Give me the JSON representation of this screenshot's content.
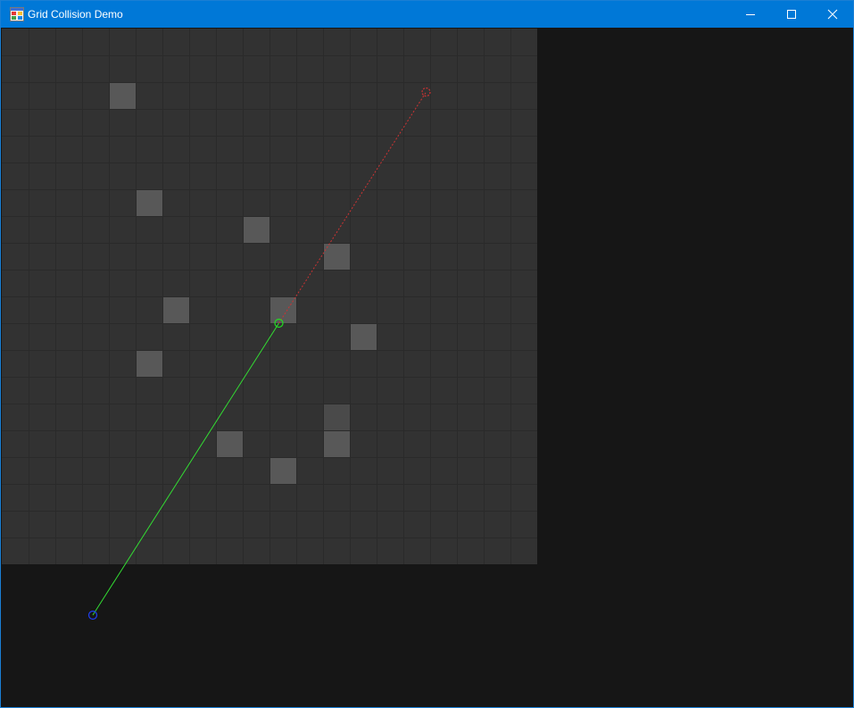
{
  "window": {
    "title": "Grid Collision Demo",
    "icon": "app-window-icon",
    "controls": [
      "minimize-icon",
      "maximize-icon",
      "close-icon"
    ],
    "titlebar_color": "#0078d7"
  },
  "scene": {
    "background_color": "#161616",
    "grid": {
      "rows": 20,
      "cols": 20,
      "cell_fill": "#323232",
      "line_color": "#2a2a2a",
      "blocked_fill": "#585858",
      "blocked_fill_dim": "#4a4a4a",
      "blocked_cells": [
        {
          "col": 4,
          "row": 2
        },
        {
          "col": 5,
          "row": 6
        },
        {
          "col": 9,
          "row": 7
        },
        {
          "col": 12,
          "row": 8
        },
        {
          "col": 6,
          "row": 10
        },
        {
          "col": 10,
          "row": 10
        },
        {
          "col": 13,
          "row": 11
        },
        {
          "col": 5,
          "row": 12
        },
        {
          "col": 12,
          "row": 14,
          "dim": true
        },
        {
          "col": 8,
          "row": 15
        },
        {
          "col": 12,
          "row": 15
        },
        {
          "col": 10,
          "row": 16
        }
      ]
    },
    "ray": {
      "start": {
        "x": 3.4,
        "y": 21.9
      },
      "hit": {
        "x": 10.35,
        "y": 11.0
      },
      "target": {
        "x": 15.85,
        "y": 2.37
      },
      "start_color": "#1f3ff0",
      "hit_color": "#22dd22",
      "clear_path_color": "#33dd33",
      "blocked_path_color": "#cc3333",
      "target_color": "#cc3333"
    }
  }
}
